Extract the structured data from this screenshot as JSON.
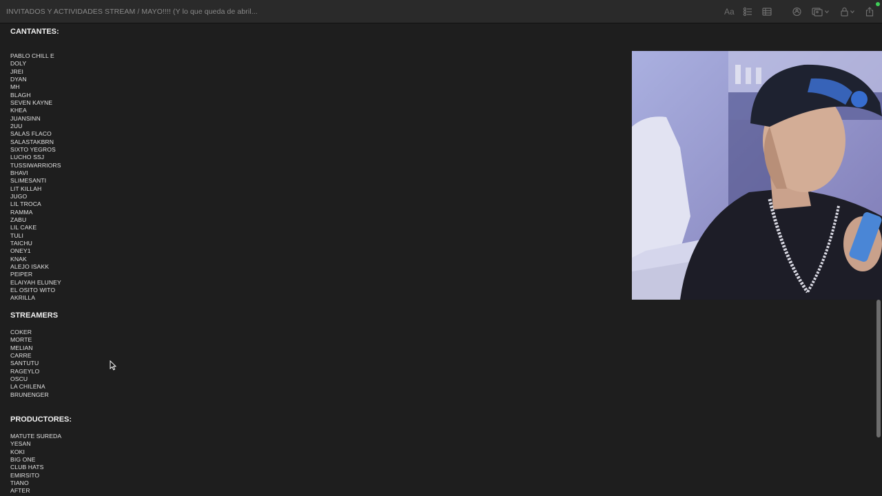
{
  "window": {
    "title": "INVITADOS Y ACTIVIDADES STREAM / MAYO!!!! (Y lo que queda de abril..."
  },
  "toolbar": {
    "format_icon": "Aa",
    "icons": [
      "text-format-icon",
      "checklist-icon",
      "table-icon",
      "collaborate-icon",
      "media-icon",
      "lock-icon",
      "share-icon"
    ]
  },
  "note": {
    "sections": [
      {
        "heading": "CANTANTES:",
        "items": [
          "PABLO CHILL E",
          "DOLY",
          "JREI",
          "DYAN",
          "MH",
          "BLAGH",
          "SEVEN KAYNE",
          "KHEA",
          "JUANSINN",
          "2UU",
          "SALAS FLACO",
          "SALASTAKBRN",
          "SIXTO YEGROS",
          "LUCHO SSJ",
          "TUSSIWARRIORS",
          "BHAVI",
          "SLIMESANTI",
          "LIT KILLAH",
          "JUGO",
          "LIL TROCA",
          "RAMMA",
          "ZABU",
          "LIL CAKE",
          "TULI",
          "TAICHU",
          "ONEY1",
          "KNAK",
          "ALEJO ISAKK",
          "PEIPER",
          "ELAIYAH ELUNEY",
          "EL OSITO WITO",
          "AKRILLA"
        ]
      },
      {
        "heading": "STREAMERS",
        "items": [
          "COKER",
          "MORTE",
          "MELIAN",
          "CARRE",
          "SANTUTU",
          "RAGEYLO",
          "OSCU",
          "LA CHILENA",
          "BRUNENGER"
        ]
      },
      {
        "heading": "PRODUCTORES:",
        "items": [
          "MATUTE SUREDA",
          "YESAN",
          "KOKI",
          "BIG ONE",
          "CLUB HATS",
          "EMIRSITO",
          "TIANO",
          "AFTER"
        ]
      }
    ]
  },
  "colors": {
    "background": "#1e1e1e",
    "toolbar": "#2a2a2a",
    "text": "#e2e2e2",
    "status_dot": "#3fcf58"
  }
}
